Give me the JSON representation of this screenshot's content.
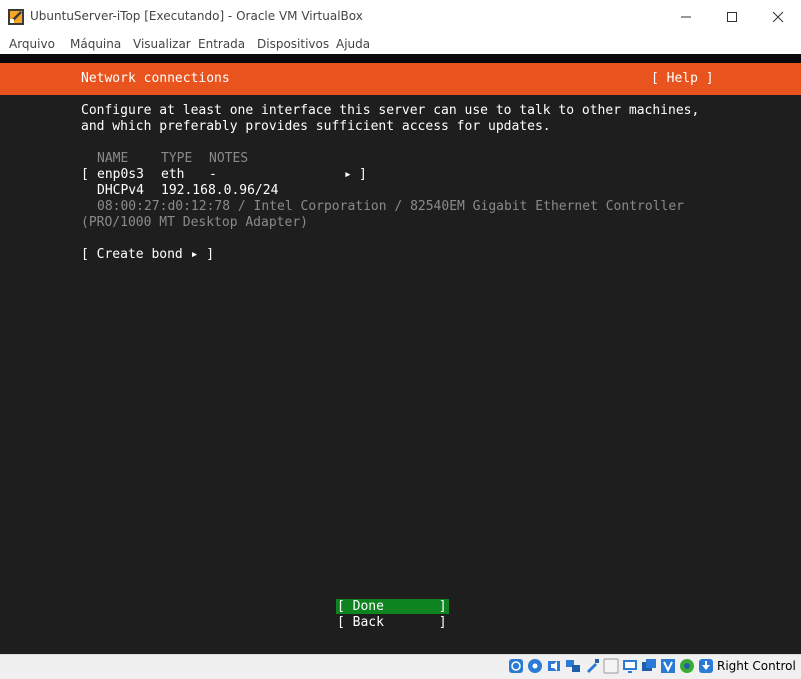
{
  "window": {
    "title": "UbuntuServer-iTop [Executando] - Oracle VM VirtualBox",
    "menu": [
      "Arquivo",
      "Máquina",
      "Visualizar",
      "Entrada",
      "Dispositivos",
      "Ajuda"
    ]
  },
  "installer": {
    "header_title": "Network connections",
    "help_label": "[ Help ]",
    "intro_line1": "Configure at least one interface this server can use to talk to other machines,",
    "intro_line2": "and which preferably provides sufficient access for updates.",
    "columns": [
      "NAME",
      "TYPE",
      "NOTES"
    ],
    "interface": {
      "open_bracket": "[",
      "name": "enp0s3",
      "type": "eth",
      "notes": "-",
      "arrow": "▸",
      "close_bracket": "]",
      "addr_method": "DHCPv4",
      "address": "192.168.0.96/24",
      "hw_line1": "08:00:27:d0:12:78 / Intel Corporation / 82540EM Gigabit Ethernet Controller",
      "hw_line2": "(PRO/1000 MT Desktop Adapter)"
    },
    "create_bond": "[ Create bond ▸ ]",
    "done": "[ Done       ]",
    "back": "[ Back       ]"
  },
  "statusbar": {
    "host_key": "Right Control",
    "icons": [
      "hard-disk-icon",
      "optical-drive-icon",
      "audio-icon",
      "network-icon",
      "usb-icon",
      "shared-folders-icon",
      "display-icon",
      "video-capture-icon",
      "recording-icon",
      "cpu-icon",
      "mouse-integration-icon",
      "host-key-arrow-icon"
    ]
  },
  "colors": {
    "header_orange": "#e9531d",
    "screen_bg": "#1e1e1e",
    "done_green": "#0e8420"
  }
}
